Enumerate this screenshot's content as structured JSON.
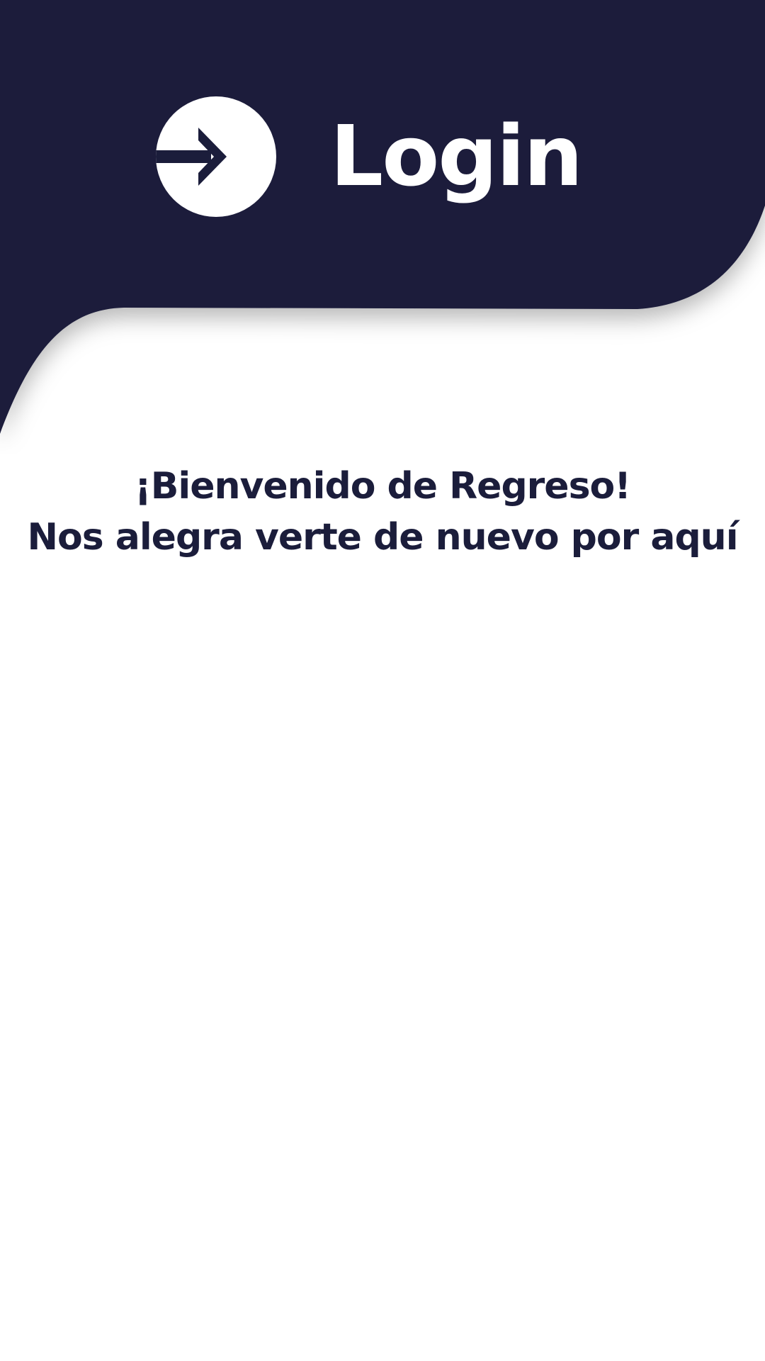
{
  "header": {
    "title": "Login",
    "icon": "login-arrow-icon",
    "background_color": "#1b1d3b",
    "text_color": "#ffffff"
  },
  "welcome": {
    "line1": "¡Bienvenido de Regreso!",
    "line2": "Nos alegra verte de nuevo por aquí",
    "text_color": "#1b1d3b"
  }
}
